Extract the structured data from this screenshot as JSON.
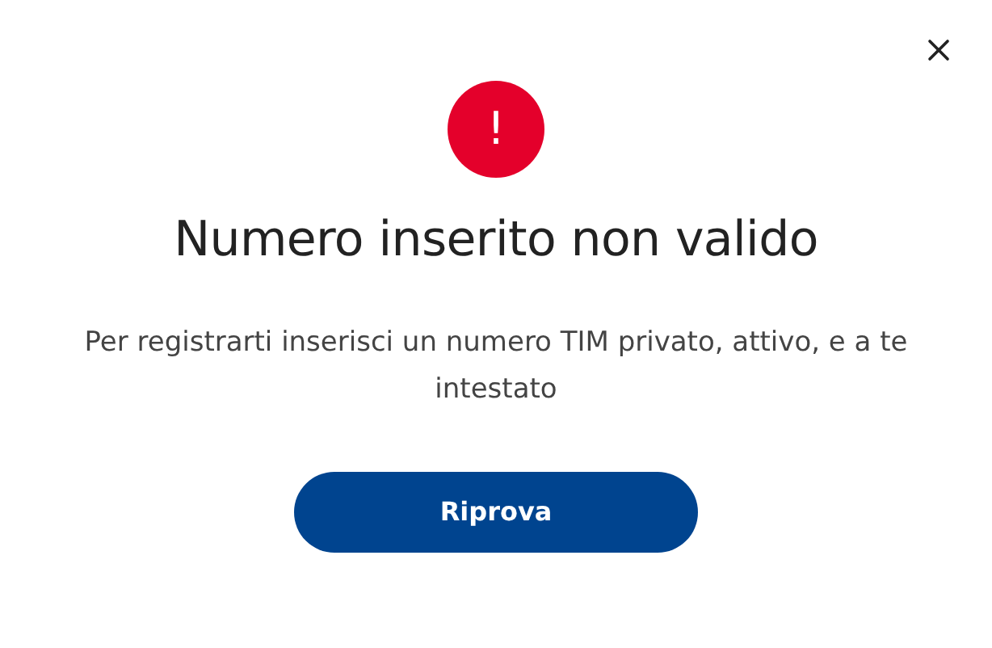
{
  "dialog": {
    "alert_mark": "!",
    "title": "Numero inserito non valido",
    "message": "Per registrarti inserisci un numero TIM privato, attivo, e a te intestato",
    "buttons": [
      "Riprova"
    ]
  }
}
